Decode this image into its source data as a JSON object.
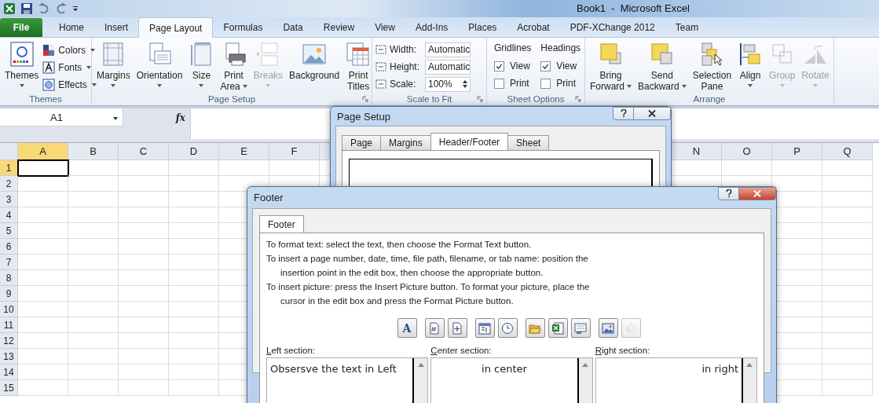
{
  "window": {
    "title": "Book1  -  Microsoft Excel"
  },
  "ribbon_tabs": [
    {
      "label": "File",
      "selected": false,
      "kind": "file"
    },
    {
      "label": "Home",
      "selected": false,
      "kind": "tab"
    },
    {
      "label": "Insert",
      "selected": false,
      "kind": "tab"
    },
    {
      "label": "Page Layout",
      "selected": true,
      "kind": "tab"
    },
    {
      "label": "Formulas",
      "selected": false,
      "kind": "tab"
    },
    {
      "label": "Data",
      "selected": false,
      "kind": "tab"
    },
    {
      "label": "Review",
      "selected": false,
      "kind": "tab"
    },
    {
      "label": "View",
      "selected": false,
      "kind": "tab"
    },
    {
      "label": "Add-Ins",
      "selected": false,
      "kind": "tab"
    },
    {
      "label": "Places",
      "selected": false,
      "kind": "tab"
    },
    {
      "label": "Acrobat",
      "selected": false,
      "kind": "tab"
    },
    {
      "label": "PDF-XChange 2012",
      "selected": false,
      "kind": "tab"
    },
    {
      "label": "Team",
      "selected": false,
      "kind": "tab"
    }
  ],
  "themes_group": {
    "label": "Themes",
    "button": {
      "lines": [
        "Themes"
      ],
      "dropdown": true
    },
    "small": [
      {
        "label": "Colors",
        "kind": "colors"
      },
      {
        "label": "Fonts",
        "kind": "fonts"
      },
      {
        "label": "Effects",
        "kind": "effects"
      }
    ]
  },
  "page_setup_group": {
    "label": "Page Setup",
    "launcher": true,
    "buttons": [
      {
        "lines": [
          "Margins"
        ],
        "kind": "margins",
        "dropdown": true,
        "disabled": false
      },
      {
        "lines": [
          "Orientation"
        ],
        "kind": "orientation",
        "dropdown": true,
        "disabled": false
      },
      {
        "lines": [
          "Size"
        ],
        "kind": "size",
        "dropdown": true,
        "disabled": false
      },
      {
        "lines": [
          "Print",
          "Area"
        ],
        "kind": "print-area",
        "dropdown": true,
        "disabled": false
      },
      {
        "lines": [
          "Breaks"
        ],
        "kind": "breaks",
        "dropdown": true,
        "disabled": true
      },
      {
        "lines": [
          "Background"
        ],
        "kind": "background",
        "dropdown": false,
        "disabled": false
      },
      {
        "lines": [
          "Print",
          "Titles"
        ],
        "kind": "print-titles",
        "dropdown": false,
        "disabled": false
      }
    ]
  },
  "scale_group": {
    "label": "Scale to Fit",
    "launcher": true,
    "fields": [
      {
        "label": "Width:",
        "value": "Automatic",
        "kind": "dropdown"
      },
      {
        "label": "Height:",
        "value": "Automatic",
        "kind": "dropdown"
      },
      {
        "label": "Scale:",
        "value": "100%",
        "kind": "spinner"
      }
    ]
  },
  "sheet_options_group": {
    "label": "Sheet Options",
    "launcher": true,
    "columns": [
      {
        "heading": "Gridlines",
        "options": [
          {
            "label": "View",
            "checked": true
          },
          {
            "label": "Print",
            "checked": false
          }
        ]
      },
      {
        "heading": "Headings",
        "options": [
          {
            "label": "View",
            "checked": true
          },
          {
            "label": "Print",
            "checked": false
          }
        ]
      }
    ]
  },
  "arrange_group": {
    "label": "Arrange",
    "buttons": [
      {
        "lines": [
          "Bring",
          "Forward"
        ],
        "kind": "bring-forward",
        "dropdown": true,
        "disabled": false
      },
      {
        "lines": [
          "Send",
          "Backward"
        ],
        "kind": "send-backward",
        "dropdown": true,
        "disabled": false
      },
      {
        "lines": [
          "Selection",
          "Pane"
        ],
        "kind": "selection-pane",
        "dropdown": false,
        "disabled": false
      },
      {
        "lines": [
          "Align"
        ],
        "kind": "align",
        "dropdown": true,
        "disabled": false
      },
      {
        "lines": [
          "Group"
        ],
        "kind": "group",
        "dropdown": true,
        "disabled": true
      },
      {
        "lines": [
          "Rotate"
        ],
        "kind": "rotate",
        "dropdown": true,
        "disabled": true
      }
    ]
  },
  "formula_bar": {
    "name_box": "A1",
    "function_label": "fx"
  },
  "sheet": {
    "columns_left": [
      {
        "label": "A",
        "selected": true
      },
      {
        "label": "B",
        "selected": false
      },
      {
        "label": "C",
        "selected": false
      },
      {
        "label": "D",
        "selected": false
      },
      {
        "label": "E",
        "selected": false
      },
      {
        "label": "F",
        "selected": false
      }
    ],
    "columns_right": [
      {
        "label": "N",
        "selected": false
      },
      {
        "label": "O",
        "selected": false
      },
      {
        "label": "P",
        "selected": false
      },
      {
        "label": "Q",
        "selected": false
      }
    ],
    "rows": [
      {
        "label": "1",
        "selected": true
      },
      {
        "label": "2",
        "selected": false
      },
      {
        "label": "3",
        "selected": false
      },
      {
        "label": "4",
        "selected": false
      },
      {
        "label": "5",
        "selected": false
      },
      {
        "label": "6",
        "selected": false
      },
      {
        "label": "7",
        "selected": false
      },
      {
        "label": "8",
        "selected": false
      },
      {
        "label": "9",
        "selected": false
      },
      {
        "label": "10",
        "selected": false
      },
      {
        "label": "11",
        "selected": false
      },
      {
        "label": "12",
        "selected": false
      },
      {
        "label": "13",
        "selected": false
      },
      {
        "label": "14",
        "selected": false
      },
      {
        "label": "15",
        "selected": false
      }
    ]
  },
  "page_setup_dialog": {
    "title": "Page Setup",
    "tabs": [
      {
        "label": "Page",
        "selected": false
      },
      {
        "label": "Margins",
        "selected": false
      },
      {
        "label": "Header/Footer",
        "selected": true
      },
      {
        "label": "Sheet",
        "selected": false
      }
    ]
  },
  "footer_dialog": {
    "title": "Footer",
    "tab": "Footer",
    "instructions": [
      {
        "lines": [
          "To format text:  select the text, then choose the Format Text button."
        ]
      },
      {
        "lines": [
          "To insert a page number, date, time, file path, filename, or tab name:  position the",
          "insertion point in the edit box, then choose the appropriate button."
        ]
      },
      {
        "lines": [
          "To insert picture: press the Insert Picture button.  To format your picture, place the",
          "cursor in the edit box and press the Format Picture button."
        ]
      }
    ],
    "toolbar": [
      [
        {
          "kind": "format-text",
          "label": "A",
          "disabled": false
        }
      ],
      [
        {
          "kind": "page-number",
          "disabled": false
        },
        {
          "kind": "page-count",
          "disabled": false
        }
      ],
      [
        {
          "kind": "date",
          "disabled": false
        },
        {
          "kind": "time",
          "disabled": false
        }
      ],
      [
        {
          "kind": "file-path",
          "disabled": false
        },
        {
          "kind": "file-name",
          "disabled": false
        },
        {
          "kind": "sheet-name",
          "disabled": false
        }
      ],
      [
        {
          "kind": "picture",
          "disabled": false
        },
        {
          "kind": "format-picture",
          "disabled": true
        }
      ]
    ],
    "sections": [
      {
        "label": "Left section:",
        "value": "Obsersve the text in Left"
      },
      {
        "label": "Center section:",
        "value": "in center"
      },
      {
        "label": "Right section:",
        "value": "in right"
      }
    ]
  }
}
